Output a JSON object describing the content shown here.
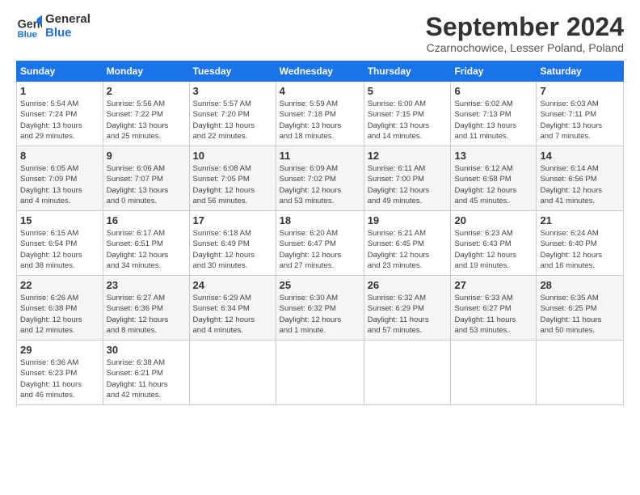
{
  "header": {
    "logo_line1": "General",
    "logo_line2": "Blue",
    "month_title": "September 2024",
    "location": "Czarnochowice, Lesser Poland, Poland"
  },
  "weekdays": [
    "Sunday",
    "Monday",
    "Tuesday",
    "Wednesday",
    "Thursday",
    "Friday",
    "Saturday"
  ],
  "weeks": [
    [
      {
        "day": "1",
        "info": "Sunrise: 5:54 AM\nSunset: 7:24 PM\nDaylight: 13 hours\nand 29 minutes."
      },
      {
        "day": "2",
        "info": "Sunrise: 5:56 AM\nSunset: 7:22 PM\nDaylight: 13 hours\nand 25 minutes."
      },
      {
        "day": "3",
        "info": "Sunrise: 5:57 AM\nSunset: 7:20 PM\nDaylight: 13 hours\nand 22 minutes."
      },
      {
        "day": "4",
        "info": "Sunrise: 5:59 AM\nSunset: 7:18 PM\nDaylight: 13 hours\nand 18 minutes."
      },
      {
        "day": "5",
        "info": "Sunrise: 6:00 AM\nSunset: 7:15 PM\nDaylight: 13 hours\nand 14 minutes."
      },
      {
        "day": "6",
        "info": "Sunrise: 6:02 AM\nSunset: 7:13 PM\nDaylight: 13 hours\nand 11 minutes."
      },
      {
        "day": "7",
        "info": "Sunrise: 6:03 AM\nSunset: 7:11 PM\nDaylight: 13 hours\nand 7 minutes."
      }
    ],
    [
      {
        "day": "8",
        "info": "Sunrise: 6:05 AM\nSunset: 7:09 PM\nDaylight: 13 hours\nand 4 minutes."
      },
      {
        "day": "9",
        "info": "Sunrise: 6:06 AM\nSunset: 7:07 PM\nDaylight: 13 hours\nand 0 minutes."
      },
      {
        "day": "10",
        "info": "Sunrise: 6:08 AM\nSunset: 7:05 PM\nDaylight: 12 hours\nand 56 minutes."
      },
      {
        "day": "11",
        "info": "Sunrise: 6:09 AM\nSunset: 7:02 PM\nDaylight: 12 hours\nand 53 minutes."
      },
      {
        "day": "12",
        "info": "Sunrise: 6:11 AM\nSunset: 7:00 PM\nDaylight: 12 hours\nand 49 minutes."
      },
      {
        "day": "13",
        "info": "Sunrise: 6:12 AM\nSunset: 6:58 PM\nDaylight: 12 hours\nand 45 minutes."
      },
      {
        "day": "14",
        "info": "Sunrise: 6:14 AM\nSunset: 6:56 PM\nDaylight: 12 hours\nand 41 minutes."
      }
    ],
    [
      {
        "day": "15",
        "info": "Sunrise: 6:15 AM\nSunset: 6:54 PM\nDaylight: 12 hours\nand 38 minutes."
      },
      {
        "day": "16",
        "info": "Sunrise: 6:17 AM\nSunset: 6:51 PM\nDaylight: 12 hours\nand 34 minutes."
      },
      {
        "day": "17",
        "info": "Sunrise: 6:18 AM\nSunset: 6:49 PM\nDaylight: 12 hours\nand 30 minutes."
      },
      {
        "day": "18",
        "info": "Sunrise: 6:20 AM\nSunset: 6:47 PM\nDaylight: 12 hours\nand 27 minutes."
      },
      {
        "day": "19",
        "info": "Sunrise: 6:21 AM\nSunset: 6:45 PM\nDaylight: 12 hours\nand 23 minutes."
      },
      {
        "day": "20",
        "info": "Sunrise: 6:23 AM\nSunset: 6:43 PM\nDaylight: 12 hours\nand 19 minutes."
      },
      {
        "day": "21",
        "info": "Sunrise: 6:24 AM\nSunset: 6:40 PM\nDaylight: 12 hours\nand 16 minutes."
      }
    ],
    [
      {
        "day": "22",
        "info": "Sunrise: 6:26 AM\nSunset: 6:38 PM\nDaylight: 12 hours\nand 12 minutes."
      },
      {
        "day": "23",
        "info": "Sunrise: 6:27 AM\nSunset: 6:36 PM\nDaylight: 12 hours\nand 8 minutes."
      },
      {
        "day": "24",
        "info": "Sunrise: 6:29 AM\nSunset: 6:34 PM\nDaylight: 12 hours\nand 4 minutes."
      },
      {
        "day": "25",
        "info": "Sunrise: 6:30 AM\nSunset: 6:32 PM\nDaylight: 12 hours\nand 1 minute."
      },
      {
        "day": "26",
        "info": "Sunrise: 6:32 AM\nSunset: 6:29 PM\nDaylight: 11 hours\nand 57 minutes."
      },
      {
        "day": "27",
        "info": "Sunrise: 6:33 AM\nSunset: 6:27 PM\nDaylight: 11 hours\nand 53 minutes."
      },
      {
        "day": "28",
        "info": "Sunrise: 6:35 AM\nSunset: 6:25 PM\nDaylight: 11 hours\nand 50 minutes."
      }
    ],
    [
      {
        "day": "29",
        "info": "Sunrise: 6:36 AM\nSunset: 6:23 PM\nDaylight: 11 hours\nand 46 minutes."
      },
      {
        "day": "30",
        "info": "Sunrise: 6:38 AM\nSunset: 6:21 PM\nDaylight: 11 hours\nand 42 minutes."
      },
      null,
      null,
      null,
      null,
      null
    ]
  ]
}
